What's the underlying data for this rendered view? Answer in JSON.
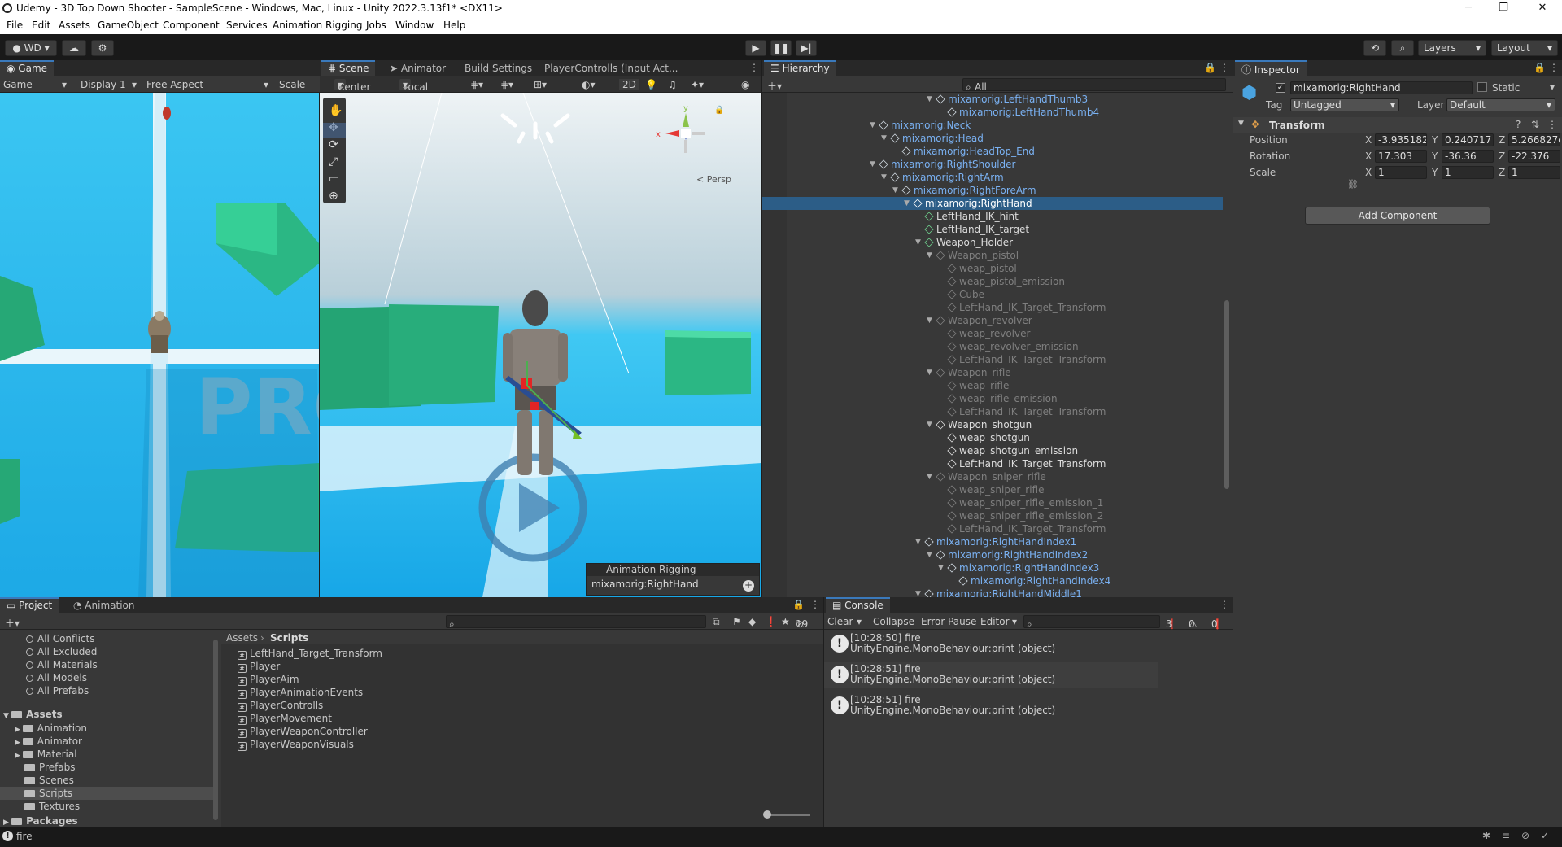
{
  "window": {
    "title": "Udemy - 3D Top Down Shooter - SampleScene - Windows, Mac, Linux - Unity 2022.3.13f1* <DX11>",
    "minimize": "─",
    "maximize": "❐",
    "close": "✕"
  },
  "menu": [
    "File",
    "Edit",
    "Assets",
    "GameObject",
    "Component",
    "Services",
    "Animation Rigging",
    "Jobs",
    "Window",
    "Help"
  ],
  "toolbar": {
    "account": "WD",
    "layers": "Layers",
    "layout": "Layout"
  },
  "game": {
    "tab": "Game",
    "mode": "Game",
    "display": "Display 1",
    "aspect": "Free Aspect",
    "scale": "Scale"
  },
  "scene": {
    "tabs": [
      "Scene",
      "Animator",
      "Build Settings",
      "PlayerControlls (Input Act..."
    ],
    "pivot": "Center",
    "space": "Local",
    "mode2d": "2D",
    "persp": "< Persp",
    "overlay_title": "Animation Rigging",
    "overlay_value": "mixamorig:RightHand"
  },
  "hierarchy": {
    "tab": "Hierarchy",
    "search": "All",
    "rows": [
      {
        "t": "mixamorig:LeftHandThumb3",
        "d": 16,
        "c": "blue",
        "a": "▼"
      },
      {
        "t": "mixamorig:LeftHandThumb4",
        "d": 17,
        "c": "blue",
        "a": ""
      },
      {
        "t": "mixamorig:Neck",
        "d": 11,
        "c": "blue",
        "a": "▼"
      },
      {
        "t": "mixamorig:Head",
        "d": 12,
        "c": "blue",
        "a": "▼"
      },
      {
        "t": "mixamorig:HeadTop_End",
        "d": 13,
        "c": "blue",
        "a": ""
      },
      {
        "t": "mixamorig:RightShoulder",
        "d": 11,
        "c": "blue",
        "a": "▼"
      },
      {
        "t": "mixamorig:RightArm",
        "d": 12,
        "c": "blue",
        "a": "▼"
      },
      {
        "t": "mixamorig:RightForeArm",
        "d": 13,
        "c": "blue",
        "a": "▼"
      },
      {
        "t": "mixamorig:RightHand",
        "d": 14,
        "c": "sel",
        "a": "▼"
      },
      {
        "t": "LeftHand_IK_hint",
        "d": 15,
        "c": "white",
        "a": "",
        "g": true
      },
      {
        "t": "LeftHand_IK_target",
        "d": 15,
        "c": "white",
        "a": "",
        "g": true
      },
      {
        "t": "Weapon_Holder",
        "d": 15,
        "c": "white",
        "a": "▼",
        "g": true
      },
      {
        "t": "Weapon_pistol",
        "d": 16,
        "c": "dim",
        "a": "▼"
      },
      {
        "t": "weap_pistol",
        "d": 17,
        "c": "dim",
        "a": ""
      },
      {
        "t": "weap_pistol_emission",
        "d": 17,
        "c": "dim",
        "a": ""
      },
      {
        "t": "Cube",
        "d": 17,
        "c": "dim",
        "a": ""
      },
      {
        "t": "LeftHand_IK_Target_Transform",
        "d": 17,
        "c": "dim",
        "a": ""
      },
      {
        "t": "Weapon_revolver",
        "d": 16,
        "c": "dim",
        "a": "▼"
      },
      {
        "t": "weap_revolver",
        "d": 17,
        "c": "dim",
        "a": ""
      },
      {
        "t": "weap_revolver_emission",
        "d": 17,
        "c": "dim",
        "a": ""
      },
      {
        "t": "LeftHand_IK_Target_Transform",
        "d": 17,
        "c": "dim",
        "a": ""
      },
      {
        "t": "Weapon_rifle",
        "d": 16,
        "c": "dim",
        "a": "▼"
      },
      {
        "t": "weap_rifle",
        "d": 17,
        "c": "dim",
        "a": ""
      },
      {
        "t": "weap_rifle_emission",
        "d": 17,
        "c": "dim",
        "a": ""
      },
      {
        "t": "LeftHand_IK_Target_Transform",
        "d": 17,
        "c": "dim",
        "a": ""
      },
      {
        "t": "Weapon_shotgun",
        "d": 16,
        "c": "white",
        "a": "▼"
      },
      {
        "t": "weap_shotgun",
        "d": 17,
        "c": "white",
        "a": ""
      },
      {
        "t": "weap_shotgun_emission",
        "d": 17,
        "c": "white",
        "a": ""
      },
      {
        "t": "LeftHand_IK_Target_Transform",
        "d": 17,
        "c": "white",
        "a": ""
      },
      {
        "t": "Weapon_sniper_rifle",
        "d": 16,
        "c": "dim",
        "a": "▼"
      },
      {
        "t": "weap_sniper_rifle",
        "d": 17,
        "c": "dim",
        "a": ""
      },
      {
        "t": "weap_sniper_rifle_emission_1",
        "d": 17,
        "c": "dim",
        "a": ""
      },
      {
        "t": "weap_sniper_rifle_emission_2",
        "d": 17,
        "c": "dim",
        "a": ""
      },
      {
        "t": "LeftHand_IK_Target_Transform",
        "d": 17,
        "c": "dim",
        "a": ""
      },
      {
        "t": "mixamorig:RightHandIndex1",
        "d": 15,
        "c": "blue",
        "a": "▼"
      },
      {
        "t": "mixamorig:RightHandIndex2",
        "d": 16,
        "c": "blue",
        "a": "▼"
      },
      {
        "t": "mixamorig:RightHandIndex3",
        "d": 17,
        "c": "blue",
        "a": "▼"
      },
      {
        "t": "mixamorig:RightHandIndex4",
        "d": 18,
        "c": "blue",
        "a": ""
      },
      {
        "t": "mixamorig:RightHandMiddle1",
        "d": 15,
        "c": "blue",
        "a": "▼"
      }
    ]
  },
  "inspector": {
    "tab": "Inspector",
    "name": "mixamorig:RightHand",
    "static": "Static",
    "tag_label": "Tag",
    "tag": "Untagged",
    "layer_label": "Layer",
    "layer": "Default",
    "component": "Transform",
    "rows": [
      {
        "label": "Position",
        "x": "-3.935182",
        "y": "0.240717",
        "z": "5.266827e"
      },
      {
        "label": "Rotation",
        "x": "17.303",
        "y": "-36.36",
        "z": "-22.376"
      },
      {
        "label": "Scale",
        "x": "1",
        "y": "1",
        "z": "1"
      }
    ],
    "axis": [
      "X",
      "Y",
      "Z"
    ],
    "add": "Add Component"
  },
  "project": {
    "tabs": [
      "Project",
      "Animation"
    ],
    "count": "19",
    "breadcrumb_root": "Assets",
    "breadcrumb_cur": "Scripts",
    "favorites": [
      "All Conflicts",
      "All Excluded",
      "All Materials",
      "All Models",
      "All Prefabs"
    ],
    "assets_label": "Assets",
    "folders": [
      "Animation",
      "Animator",
      "Material",
      "Prefabs",
      "Scenes",
      "Scripts",
      "Textures"
    ],
    "packages": "Packages",
    "files": [
      "LeftHand_Target_Transform",
      "Player",
      "PlayerAim",
      "PlayerAnimationEvents",
      "PlayerControlls",
      "PlayerMovement",
      "PlayerWeaponController",
      "PlayerWeaponVisuals"
    ]
  },
  "console": {
    "tab": "Console",
    "clear": "Clear",
    "collapse": "Collapse",
    "errorpause": "Error Pause",
    "editor": "Editor",
    "logs": "3",
    "warnings": "0",
    "errors": "0",
    "entries": [
      {
        "line1": "[10:28:50] fire",
        "line2": "UnityEngine.MonoBehaviour:print (object)"
      },
      {
        "line1": "[10:28:51] fire",
        "line2": "UnityEngine.MonoBehaviour:print (object)"
      },
      {
        "line1": "[10:28:51] fire",
        "line2": "UnityEngine.MonoBehaviour:print (object)"
      }
    ]
  },
  "statusbar": {
    "text": "fire"
  }
}
